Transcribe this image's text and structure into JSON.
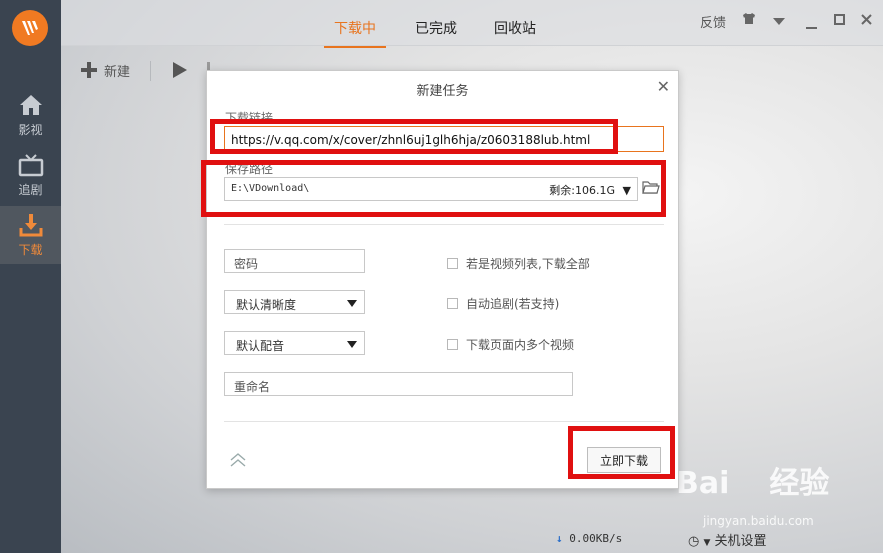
{
  "sidebar": {
    "items": [
      {
        "label": "影视",
        "icon": "home-icon"
      },
      {
        "label": "追剧",
        "icon": "tv-icon"
      },
      {
        "label": "下载",
        "icon": "download-icon"
      }
    ]
  },
  "tabs": [
    {
      "label": "下载中",
      "active": true
    },
    {
      "label": "已完成",
      "active": false
    },
    {
      "label": "回收站",
      "active": false
    }
  ],
  "window": {
    "feedback": "反馈"
  },
  "toolbar": {
    "new_label": "新建"
  },
  "status": {
    "speed": "0.00KB/s",
    "shutdown": "关机设置"
  },
  "watermark": {
    "brand": "Bai du 经验",
    "url": "jingyan.baidu.com"
  },
  "dialog": {
    "title": "新建任务",
    "url_label": "下载链接",
    "url_value": "https://v.qq.com/x/cover/zhnl6uj1glh6hja/z0603188lub.html",
    "path_label": "保存路径",
    "path_value": "E:\\VDownload\\",
    "free_space": "剩余:106.1G",
    "password_placeholder": "密码",
    "quality_value": "默认清晰度",
    "dub_value": "默认配音",
    "rename_placeholder": "重命名",
    "checks": [
      "若是视频列表,下载全部",
      "自动追剧(若支持)",
      "下载页面内多个视频"
    ],
    "download_now": "立即下载"
  },
  "colors": {
    "accent": "#e8741e",
    "annotation": "#e01010",
    "sidebar": "#3a4450"
  }
}
